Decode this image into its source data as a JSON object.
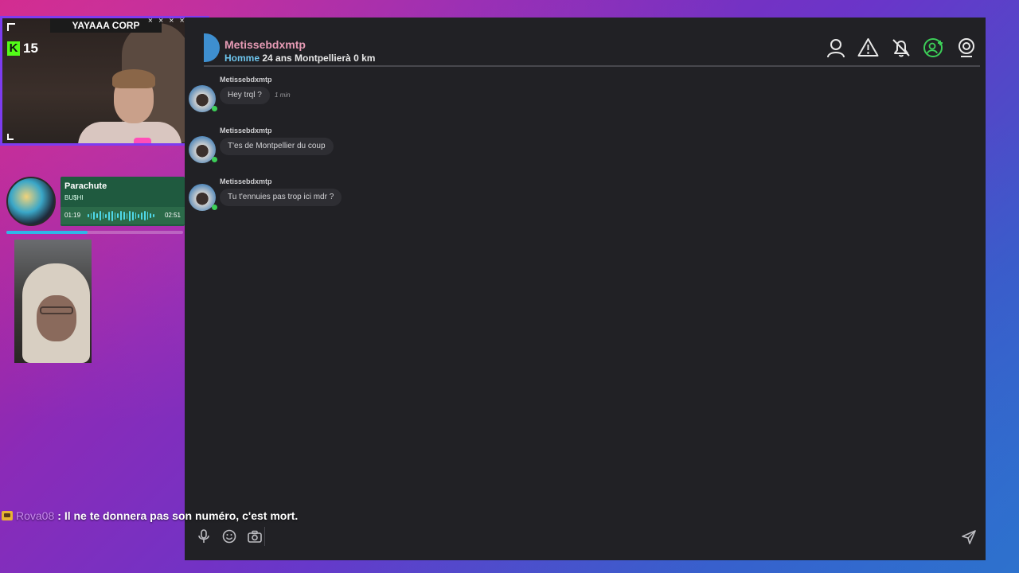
{
  "overlay": {
    "cam_banner": "YAYAAA CORP",
    "kick_count": "15",
    "kick_letter": "K"
  },
  "music": {
    "title": "Parachute",
    "artist": "BU$HI",
    "elapsed": "01:19",
    "duration": "02:51",
    "progress": 0.46
  },
  "chat": {
    "contact": {
      "name": "Metissebdxmtp",
      "gender": "Homme",
      "details": "24 ans Montpellierà 0 km"
    },
    "header_icons": [
      "profile-icon",
      "report-icon",
      "mute-notifications-icon",
      "add-friend-icon",
      "webcam-icon"
    ],
    "messages": [
      {
        "author": "Metissebdxmtp",
        "text": "Hey trql ?",
        "time": "1 min"
      },
      {
        "author": "Metissebdxmtp",
        "text": "T'es de Montpellier du coup",
        "time": ""
      },
      {
        "author": "Metissebdxmtp",
        "text": "Tu t'ennuies pas trop ici mdr ?",
        "time": ""
      }
    ],
    "input_icons": [
      "microphone-icon",
      "emoji-icon",
      "camera-icon"
    ]
  },
  "stream_chat": {
    "username": "Rova08",
    "message": ": Il ne te donnera pas son numéro, c'est mort."
  },
  "colors": {
    "accent_purple": "#7d3cf0",
    "music_green": "#1f5a3f",
    "name_pink": "#e79bb5",
    "gender_blue": "#6ec6ee",
    "online_green": "#3ccf58",
    "add_friend_green": "#3ccf58"
  }
}
